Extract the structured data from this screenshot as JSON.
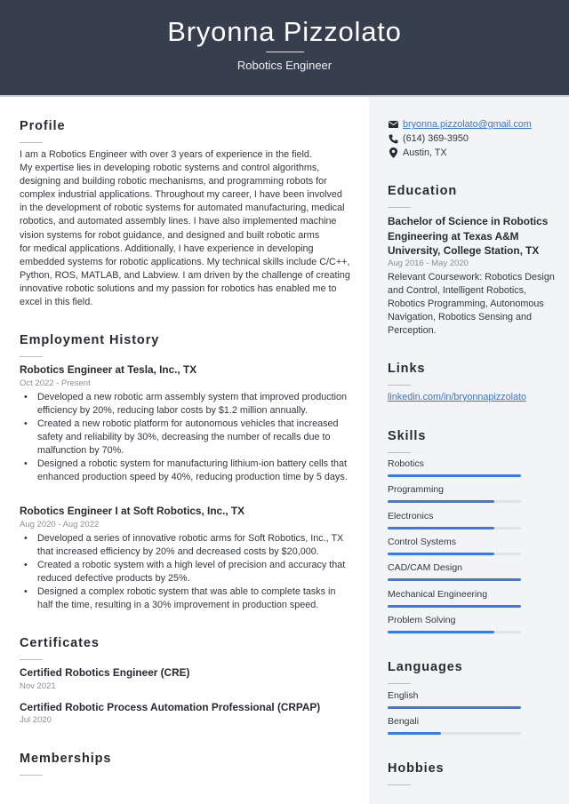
{
  "header": {
    "name": "Bryonna Pizzolato",
    "title": "Robotics Engineer"
  },
  "profile": {
    "heading": "Profile",
    "lines": [
      "I am a Robotics Engineer with over 3 years of experience in the field.",
      "My expertise lies in developing robotic systems and control algorithms,",
      "designing and building robotic mechanisms, and programming robots for",
      "complex industrial applications. Throughout my career, I have been involved",
      "in the development of robotic systems for automated manufacturing, medical",
      "robotics, and automated assembly lines. I have also implemented machine",
      "vision systems for robot guidance, and designed and built robotic arms",
      "for medical applications. Additionally, I have experience in developing",
      "embedded systems for robotic applications. My technical skills include C/C++,",
      "Python, ROS, MATLAB, and Labview. I am driven by the challenge of creating",
      "innovative robotic solutions and my passion for robotics has enabled me to",
      "excel in this field."
    ]
  },
  "employment": {
    "heading": "Employment History",
    "jobs": [
      {
        "title": "Robotics Engineer at Tesla, Inc., TX",
        "dates": "Oct 2022 - Present",
        "bullets": [
          "Developed a new robotic arm assembly system that improved production efficiency by 20%, reducing labor costs by $1.2 million annually.",
          "Created a new robotic platform for autonomous vehicles that increased safety and reliability by 30%, decreasing the number of recalls due to malfunction by 70%.",
          "Designed a robotic system for manufacturing lithium-ion battery cells that enhanced production speed by 40%, reducing production time by 5 days."
        ]
      },
      {
        "title": "Robotics Engineer I at Soft Robotics, Inc., TX",
        "dates": "Aug 2020 - Aug 2022",
        "bullets": [
          "Developed a series of innovative robotic arms for Soft Robotics, Inc., TX that increased efficiency by 20% and decreased costs by $20,000.",
          "Created a robotic system with a high level of precision and accuracy that reduced defective products by 25%.",
          "Designed a complex robotic system that was able to complete tasks in half the time, resulting in a 30% improvement in production speed."
        ]
      }
    ]
  },
  "certificates": {
    "heading": "Certificates",
    "items": [
      {
        "name": "Certified Robotics Engineer (CRE)",
        "date": "Nov 2021"
      },
      {
        "name": "Certified Robotic Process Automation Professional (CRPAP)",
        "date": "Jul 2020"
      }
    ]
  },
  "memberships": {
    "heading": "Memberships"
  },
  "contact": {
    "email": "bryonna.pizzolato@gmail.com",
    "phone": "(614) 369-3950",
    "location": "Austin, TX",
    "icons": [
      "envelope-icon",
      "phone-icon",
      "map-pin-icon"
    ]
  },
  "education": {
    "heading": "Education",
    "degree_lines": [
      "Bachelor of Science in Robotics",
      "Engineering at Texas A&M",
      "University, College Station, TX"
    ],
    "dates": "Aug 2016 - May 2020",
    "coursework_lines": [
      "Relevant Coursework: Robotics Design",
      "and Control, Intelligent Robotics,",
      "Robotics Programming, Autonomous",
      "Navigation, Robotics Sensing and",
      "Perception."
    ]
  },
  "links": {
    "heading": "Links",
    "items": [
      "linkedin.com/in/bryonnapizzolato"
    ]
  },
  "skills": {
    "heading": "Skills",
    "items": [
      {
        "name": "Robotics",
        "level": 1.0
      },
      {
        "name": "Programming",
        "level": 0.8
      },
      {
        "name": "Electronics",
        "level": 0.8
      },
      {
        "name": "Control Systems",
        "level": 0.8
      },
      {
        "name": "CAD/CAM Design",
        "level": 1.0
      },
      {
        "name": "Mechanical Engineering",
        "level": 1.0
      },
      {
        "name": "Problem Solving",
        "level": 0.8
      }
    ]
  },
  "languages": {
    "heading": "Languages",
    "items": [
      {
        "name": "English",
        "level": 1.0
      },
      {
        "name": "Bengali",
        "level": 0.4
      }
    ]
  },
  "hobbies": {
    "heading": "Hobbies"
  },
  "colors": {
    "header_bg": "#373f4f",
    "accent": "#3a7ae8",
    "link": "#3b73d6",
    "sidebar_bg": "#f3f4f6"
  }
}
